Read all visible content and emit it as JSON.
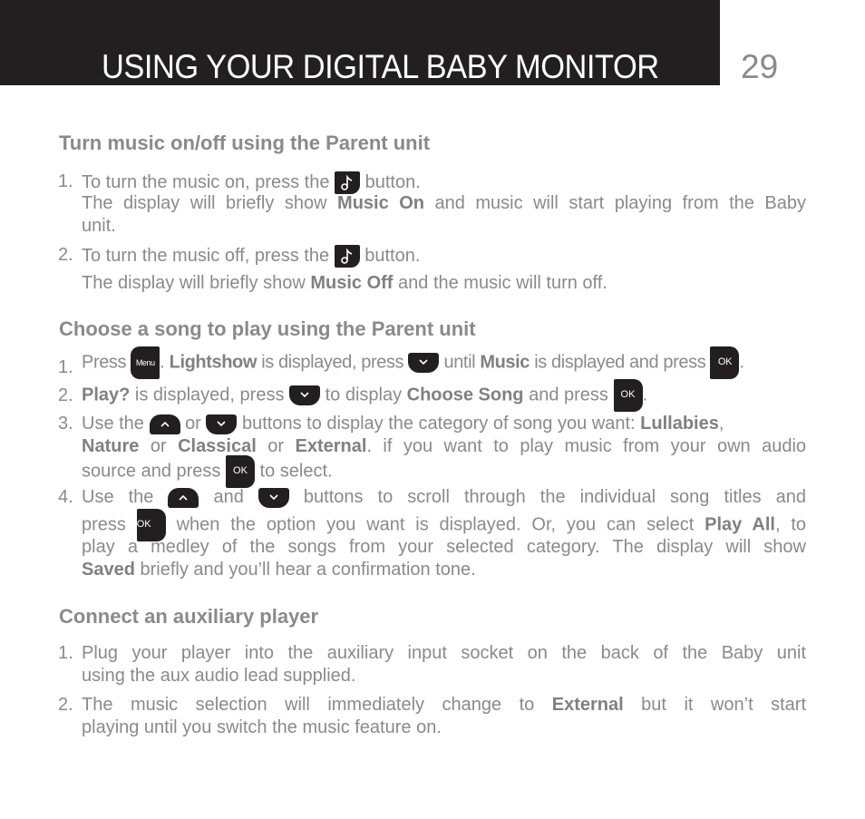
{
  "header": {
    "title": "USING YOUR DIGITAL BABY MONITOR",
    "page_number": "29"
  },
  "sections": [
    {
      "title": "Turn music on/off using the Parent unit",
      "steps": [
        {
          "num": "1.",
          "a": "To turn the music on, press the",
          "b": "button.",
          "c1": "The display will briefly show",
          "c_bold": "Music On",
          "c2": "and music will start playing from the Baby",
          "d": "unit."
        },
        {
          "num": "2.",
          "a": "To turn the music off, press the",
          "b": "button.",
          "c1": "The display will briefly show",
          "c_bold": "Music Off",
          "c2": "and the music will turn off."
        }
      ]
    },
    {
      "title": "Choose a song to play using the Parent unit",
      "steps": [
        {
          "num": "1.",
          "t1": "Press",
          "icon1": "Menu",
          "t2": ".",
          "b1": "Lightshow",
          "t3": "is displayed, press",
          "t4": "until",
          "b2": "Music",
          "t5": "is displayed and press",
          "icon2": "OK",
          "t6": "."
        },
        {
          "num": "2.",
          "b1": "Play?",
          "t1": "is displayed, press",
          "t2": "to display",
          "b2": "Choose Song",
          "t3": "and press",
          "icon": "OK",
          "t4": "."
        },
        {
          "num": "3.",
          "t1": "Use the",
          "t2": "or",
          "t3": "buttons to display the category of song you want:",
          "b1": "Lullabies",
          "t4": ",",
          "b2": "Nature",
          "t5": "or",
          "b3": "Classical",
          "t6": "or",
          "b4": "External",
          "t7": ". if you want to play music from your own audio",
          "t8": "source and press",
          "icon": "OK",
          "t9": "to select."
        },
        {
          "num": "4.",
          "t1": "Use the",
          "t2": "and",
          "t3": "buttons to scroll through the individual song titles and",
          "t4": "press",
          "icon": "OK",
          "t5": "when the option you want is displayed. Or, you can select",
          "b1": "Play All",
          "t6": ", to",
          "t7": "play a medley of the songs from your selected category. The display will show",
          "b2": "Saved",
          "t8": "briefly and you’ll hear a confirmation tone."
        }
      ]
    },
    {
      "title": "Connect an auxiliary player",
      "steps": [
        {
          "num": "1.",
          "l1": "Plug your player into the auxiliary input socket on the back of the Baby unit",
          "l2": "using the aux audio lead supplied."
        },
        {
          "num": "2.",
          "l1a": "The music selection will immediately change to",
          "b": "External",
          "l1b": "but it won’t start",
          "l2": "playing until you switch the music feature on."
        }
      ]
    }
  ],
  "icons": {
    "music": "music-note-icon",
    "menu": "menu-button-icon",
    "ok": "ok-button-icon",
    "up": "up-arrow-button-icon",
    "down": "down-arrow-button-icon"
  }
}
